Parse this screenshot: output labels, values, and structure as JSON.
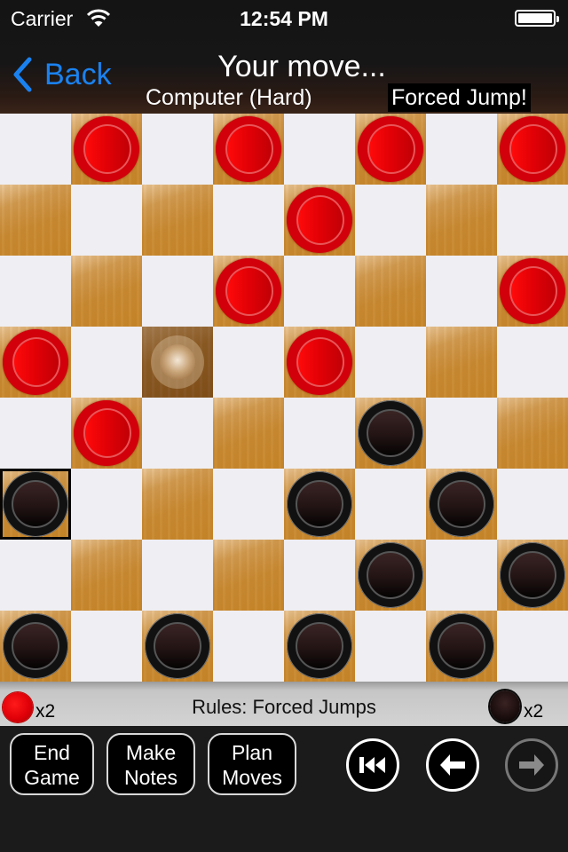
{
  "status_bar": {
    "carrier": "Carrier",
    "time": "12:54 PM",
    "wifi_icon": "wifi-icon",
    "battery_icon": "battery-full-icon"
  },
  "nav": {
    "back_label": "Back",
    "title": "Your move...",
    "opponent": "Computer (Hard)",
    "alert": "Forced Jump!"
  },
  "colors": {
    "accent": "#1a82f0",
    "red_piece": "#d1000a",
    "black_piece": "#111111",
    "light_square": "#efeef3",
    "dark_square": "#c98a32"
  },
  "board": {
    "size": 8,
    "dark_on_odd_sum": true,
    "selected": [
      5,
      0
    ],
    "ghost": [
      3,
      2
    ],
    "pieces": [
      {
        "row": 0,
        "col": 1,
        "color": "red"
      },
      {
        "row": 0,
        "col": 3,
        "color": "red"
      },
      {
        "row": 0,
        "col": 5,
        "color": "red"
      },
      {
        "row": 0,
        "col": 7,
        "color": "red"
      },
      {
        "row": 1,
        "col": 4,
        "color": "red"
      },
      {
        "row": 2,
        "col": 3,
        "color": "red"
      },
      {
        "row": 2,
        "col": 7,
        "color": "red"
      },
      {
        "row": 3,
        "col": 0,
        "color": "red"
      },
      {
        "row": 3,
        "col": 4,
        "color": "red"
      },
      {
        "row": 4,
        "col": 1,
        "color": "red"
      },
      {
        "row": 4,
        "col": 5,
        "color": "black"
      },
      {
        "row": 5,
        "col": 0,
        "color": "black"
      },
      {
        "row": 5,
        "col": 4,
        "color": "black"
      },
      {
        "row": 5,
        "col": 6,
        "color": "black"
      },
      {
        "row": 6,
        "col": 5,
        "color": "black"
      },
      {
        "row": 6,
        "col": 7,
        "color": "black"
      },
      {
        "row": 7,
        "col": 0,
        "color": "black"
      },
      {
        "row": 7,
        "col": 2,
        "color": "black"
      },
      {
        "row": 7,
        "col": 4,
        "color": "black"
      },
      {
        "row": 7,
        "col": 6,
        "color": "black"
      }
    ]
  },
  "info_bar": {
    "red_captured": "x2",
    "black_captured": "x2",
    "rules": "Rules: Forced Jumps"
  },
  "toolbar": {
    "buttons": [
      {
        "line1": "End",
        "line2": "Game"
      },
      {
        "line1": "Make",
        "line2": "Notes"
      },
      {
        "line1": "Plan",
        "line2": "Moves"
      }
    ],
    "controls": [
      {
        "icon": "rewind-to-start-icon",
        "enabled": true
      },
      {
        "icon": "arrow-left-icon",
        "enabled": true
      },
      {
        "icon": "arrow-right-icon",
        "enabled": false
      }
    ]
  }
}
